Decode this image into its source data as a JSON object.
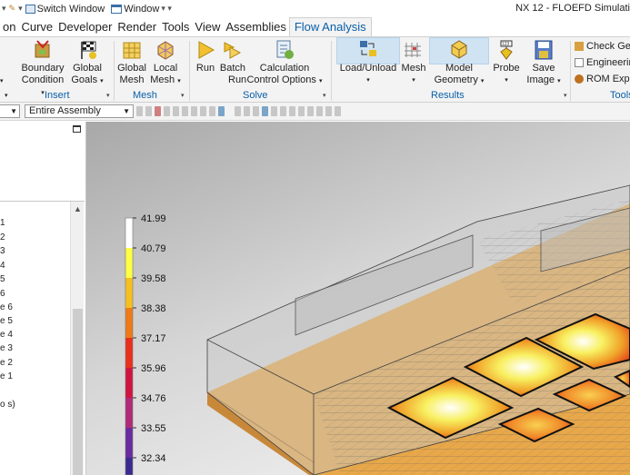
{
  "title_bar": {
    "quick_access": {
      "switch_window": "Switch Window",
      "window": "Window"
    },
    "window_title": "NX 12 - FLOEFD Simulati"
  },
  "menu": {
    "tabs": [
      "on",
      "Curve",
      "Developer",
      "Render",
      "Tools",
      "View",
      "Assemblies",
      "Flow Analysis"
    ],
    "active": "Flow Analysis"
  },
  "ribbon": {
    "groups": {
      "insert": {
        "label": "Insert",
        "buttons": [
          {
            "line1": "Boundary",
            "line2": "Condition"
          },
          {
            "line1": "Global",
            "line2": "Goals"
          }
        ]
      },
      "mesh": {
        "label": "Mesh",
        "buttons": [
          {
            "line1": "Global",
            "line2": "Mesh"
          },
          {
            "line1": "Local",
            "line2": "Mesh"
          }
        ]
      },
      "solve": {
        "label": "Solve",
        "buttons": [
          {
            "line1": "Run",
            "line2": ""
          },
          {
            "line1": "Batch",
            "line2": "Run"
          },
          {
            "line1": "Calculation",
            "line2": "Control Options"
          }
        ]
      },
      "results": {
        "label": "Results",
        "buttons": [
          {
            "line1": "Load/Unload",
            "line2": ""
          },
          {
            "line1": "Mesh",
            "line2": ""
          },
          {
            "line1": "Model",
            "line2": "Geometry"
          },
          {
            "line1": "Probe",
            "line2": ""
          },
          {
            "line1": "Save",
            "line2": "Image"
          }
        ]
      },
      "tools": {
        "label": "Tools",
        "items": [
          "Check Geo",
          "Engineering",
          "ROM Expo"
        ]
      }
    }
  },
  "selection_bar": {
    "filter_value": "Entire Assembly"
  },
  "left_panel": {
    "items": [
      "1",
      "2",
      "3",
      "4",
      "5",
      "6",
      "e 6",
      "e 5",
      "e 4",
      "e 3",
      "e 2",
      "e 1",
      "",
      "o s)"
    ]
  },
  "legend": {
    "values": [
      "41.99",
      "40.79",
      "39.58",
      "38.38",
      "37.17",
      "35.96",
      "34.76",
      "33.55",
      "32.34"
    ],
    "colors": [
      "#ffffff",
      "#ffff44",
      "#f4c020",
      "#ef7a18",
      "#e8301c",
      "#d01440",
      "#b02a78",
      "#6a2aa0",
      "#3a2a90"
    ]
  },
  "colors": {
    "accent": "#0a5fa8",
    "ribbon_bg": "#f3f3f3",
    "viewport_bg": "#d4d4d4",
    "board": "#e8a84a"
  }
}
